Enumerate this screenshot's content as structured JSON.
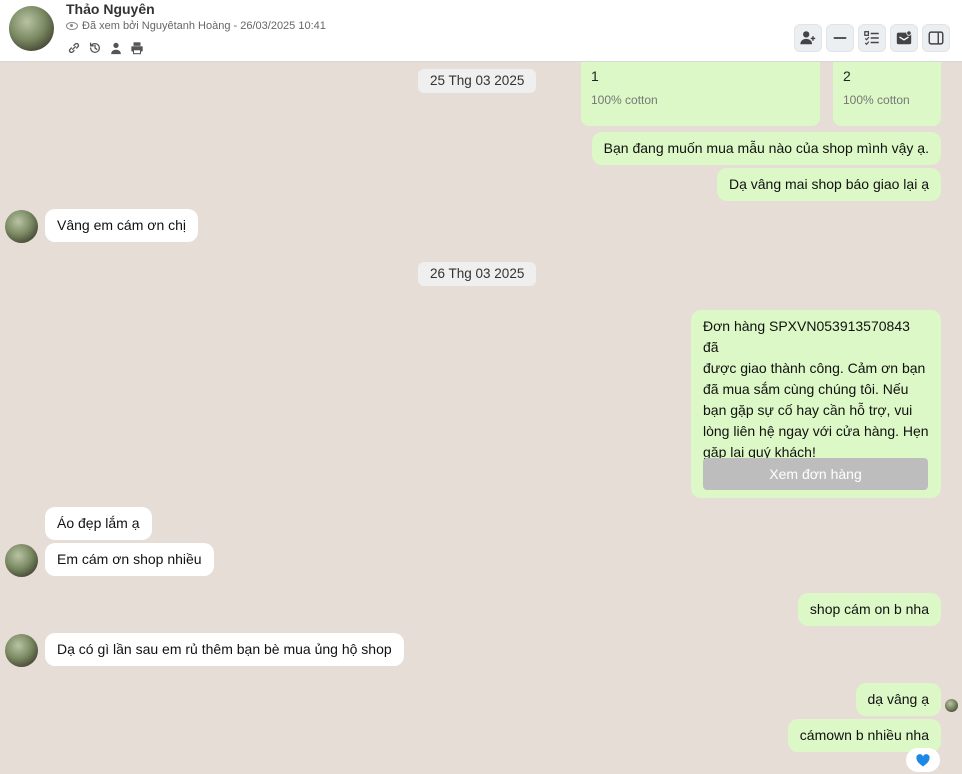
{
  "header": {
    "contact_name": "Thảo Nguyên",
    "seen_by": "Đã xem bởi Nguyêtanh Hoàng - 26/03/2025 10:41",
    "meta_icons": [
      "link-icon",
      "history-icon",
      "person-icon",
      "printer-icon"
    ],
    "toolbar_icons": [
      "add-user-icon",
      "minimize-icon",
      "list-icon",
      "inbox-icon",
      "sidebar-toggle-icon"
    ]
  },
  "products": [
    {
      "name": "1",
      "material": "100% cotton"
    },
    {
      "name": "2",
      "material": "100% cotton"
    }
  ],
  "dates": [
    "25 Thg 03 2025",
    "26 Thg 03 2025"
  ],
  "messages": {
    "out_ask": "Bạn đang muốn mua mẫu nào của shop mình vậy ạ.",
    "out_delivery": "Dạ vâng mai shop báo giao lại ạ",
    "in_thanks": "Vâng em cám ơn chị",
    "order_notice": "Đơn hàng SPXVN053913570843 đã\nđược giao thành công. Cảm ơn bạn\nđã mua sắm cùng chúng tôi. Nếu\nbạn gặp sự cố hay cần hỗ trợ, vui\nlòng liên hệ ngay với cửa hàng. Hẹn\ngặp lại quý khách!",
    "order_button": "Xem đơn hàng",
    "in_nice": "Áo đẹp lắm ạ",
    "in_thanks_shop": "Em cám ơn shop nhiều",
    "out_thanks": "shop cám on b nha",
    "in_next_time": "Dạ có gì lần sau em rủ thêm bạn bè mua ủng hộ shop",
    "out_yes": "dạ vâng ạ",
    "out_thanks_more": "cámown b nhiều  nha"
  },
  "reaction_icon": "heart-icon",
  "colors": {
    "outgoing": "#dcf8c6",
    "incoming": "#ffffff",
    "background": "#e6ddd6",
    "reaction": "#1e88e5"
  }
}
